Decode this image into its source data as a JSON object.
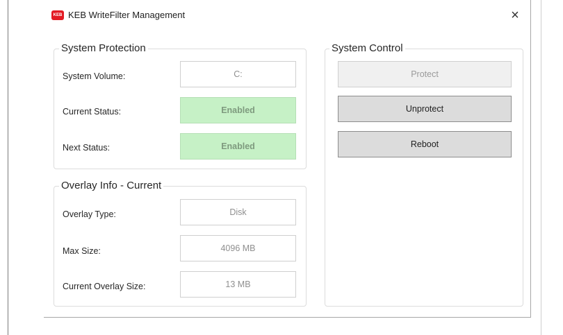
{
  "window": {
    "logo_text": "KEB",
    "title": "KEB WriteFilter Management",
    "close_glyph": "×"
  },
  "system_protection": {
    "title": "System Protection",
    "rows": [
      {
        "label": "System Volume:",
        "value": "C:"
      },
      {
        "label": "Current Status:",
        "value": "Enabled"
      },
      {
        "label": "Next Status:",
        "value": "Enabled"
      }
    ]
  },
  "overlay_info": {
    "title": "Overlay Info - Current",
    "rows": [
      {
        "label": "Overlay Type:",
        "value": "Disk"
      },
      {
        "label": "Max Size:",
        "value": "4096 MB"
      },
      {
        "label": "Current Overlay Size:",
        "value": "13 MB"
      }
    ]
  },
  "system_control": {
    "title": "System Control",
    "buttons": [
      {
        "label": "Protect",
        "enabled": false
      },
      {
        "label": "Unprotect",
        "enabled": true
      },
      {
        "label": "Reboot",
        "enabled": true
      }
    ]
  },
  "colors": {
    "brand": "#e31b23",
    "status_enabled_bg": "#c6f1c6"
  },
  "icons": {
    "logo": "keb-logo-icon",
    "close": "close-icon"
  }
}
